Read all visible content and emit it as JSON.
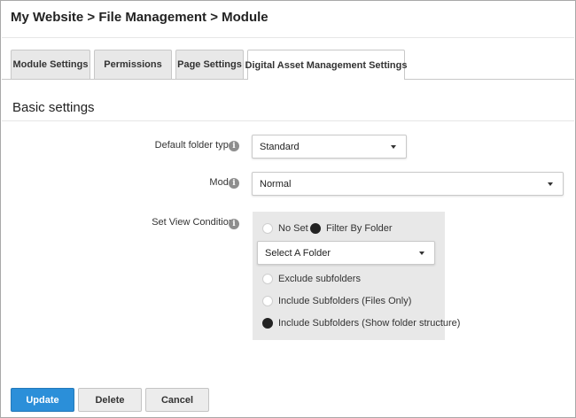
{
  "breadcrumb": "My Website > File Management > Module",
  "tabs": [
    {
      "label": "Module Settings",
      "active": false
    },
    {
      "label": "Permissions",
      "active": false
    },
    {
      "label": "Page Settings",
      "active": false
    },
    {
      "label": "Digital Asset Management Settings",
      "active": true
    }
  ],
  "section_title": "Basic settings",
  "fields": {
    "folder_type": {
      "label": "Default folder type:",
      "value": "Standard"
    },
    "mode": {
      "label": "Mode:",
      "value": "Normal"
    },
    "view_condition": {
      "label": "Set View Condition:",
      "options": {
        "no_set": "No Set",
        "filter_by_folder": "Filter By Folder"
      },
      "selected": "filter_by_folder",
      "folder_placeholder": "Select A Folder",
      "subfolder_options": {
        "exclude": "Exclude subfolders",
        "files_only": "Include Subfolders (Files Only)",
        "show_structure": "Include Subfolders (Show folder structure)"
      },
      "subfolder_selected": "show_structure"
    }
  },
  "info_glyph": "i",
  "buttons": {
    "update": "Update",
    "delete": "Delete",
    "cancel": "Cancel"
  },
  "colors": {
    "primary": "#2b8fd9",
    "tab_bg": "#e8e8e8",
    "panel_bg": "#e8e8e8"
  }
}
